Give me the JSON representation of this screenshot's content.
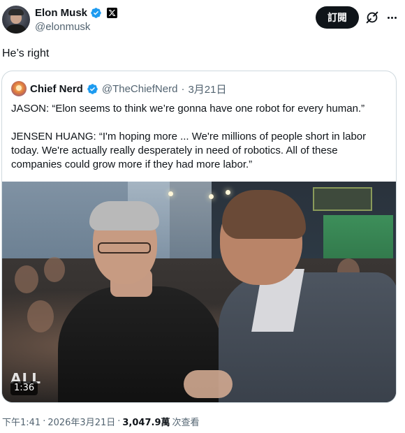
{
  "author": {
    "display_name": "Elon Musk",
    "handle": "@elonmusk",
    "verified_badge_color": "#1d9bf0",
    "affiliate_badge": "x-logo-icon"
  },
  "header": {
    "subscribe_label": "訂閱",
    "grok_icon": "grok-icon",
    "more_icon": "more-dots-icon"
  },
  "post": {
    "text": "He’s right"
  },
  "quote": {
    "display_name": "Chief Nerd",
    "handle": "@TheChiefNerd",
    "separator": "·",
    "date": "3月21日",
    "paragraph1": "JASON: “Elon seems to think we’re gonna have one robot for every human.”",
    "paragraph2": "JENSEN HUANG: “I'm hoping more ... We're millions of people short in labor today. We're actually really desperately in need of robotics. All of these companies could grow more if they had more labor.”",
    "video": {
      "duration": "1:36",
      "watermark": "All-In"
    }
  },
  "footer": {
    "time": "下午1:41",
    "sep1": "·",
    "date": "2026年3月21日",
    "sep2": "·",
    "views_count": "3,047.9萬",
    "views_label": "次查看"
  }
}
